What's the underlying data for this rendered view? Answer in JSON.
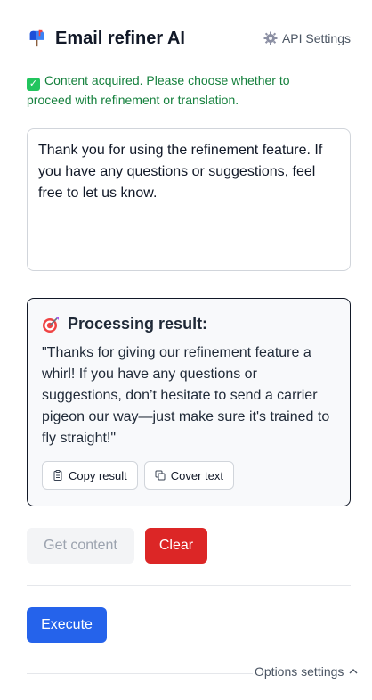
{
  "header": {
    "title": "Email refiner AI",
    "brand_icon": "mailbox-icon",
    "api_settings_label": "API Settings",
    "api_settings_icon": "gear-icon"
  },
  "status": {
    "icon": "check-icon",
    "message": "Content acquired. Please choose whether to proceed with refinement or translation.",
    "color": "#15803d"
  },
  "input": {
    "value": "Thank you for using the refinement feature. If you have any questions or suggestions, feel free to let us know."
  },
  "result": {
    "icon": "target-icon",
    "title": "Processing result:",
    "text": "\"Thanks for giving our refinement feature a whirl! If you have any questions or suggestions, don’t hesitate to send a carrier pigeon our way—just make sure it's trained to fly straight!\"",
    "copy_label": "Copy result",
    "cover_label": "Cover text"
  },
  "actions": {
    "get_content_label": "Get content",
    "clear_label": "Clear",
    "execute_label": "Execute"
  },
  "footer": {
    "options_label": "Options settings"
  },
  "colors": {
    "accent": "#2563eb",
    "danger": "#dc2626",
    "success": "#15803d"
  }
}
